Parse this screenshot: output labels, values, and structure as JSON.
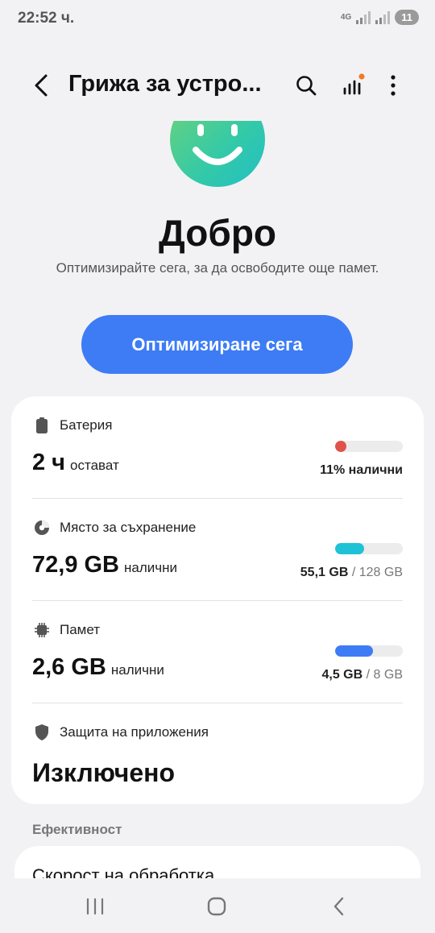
{
  "status_bar": {
    "time": "22:52 ч.",
    "network": "4G",
    "battery": "11"
  },
  "app_bar": {
    "title": "Грижа за устро...",
    "icons": [
      "back-icon",
      "search-icon",
      "stats-icon",
      "more-icon"
    ],
    "notification_dot_color": "#f07a2a"
  },
  "hero": {
    "status": "Добро",
    "description": "Оптимизирайте сега, за да освободите още памет.",
    "button_label": "Оптимизиране сега",
    "button_color": "#3d7cf5"
  },
  "items": {
    "battery": {
      "label": "Батерия",
      "value": "2 ч",
      "unit": "остават",
      "stat": "11% налични",
      "level_percent": 11,
      "color": "#e0534a"
    },
    "storage": {
      "label": "Място за съхранение",
      "value": "72,9 GB",
      "unit": "налични",
      "used": "55,1 GB",
      "separator": "/",
      "total": "128 GB",
      "fill_percent": 43,
      "color": "#1ec2d6"
    },
    "memory": {
      "label": "Памет",
      "value": "2,6 GB",
      "unit": "налични",
      "used": "4,5 GB",
      "separator": "/",
      "total": "8 GB",
      "fill_percent": 56,
      "color": "#3d7cf5"
    },
    "protection": {
      "label": "Защита на приложения",
      "value": "Изключено"
    }
  },
  "efficiency": {
    "section_label": "Ефективност",
    "first_item": "Скорост на обработка"
  },
  "nav_bar": {
    "icons": [
      "recents-icon",
      "home-icon",
      "back-nav-icon"
    ]
  }
}
